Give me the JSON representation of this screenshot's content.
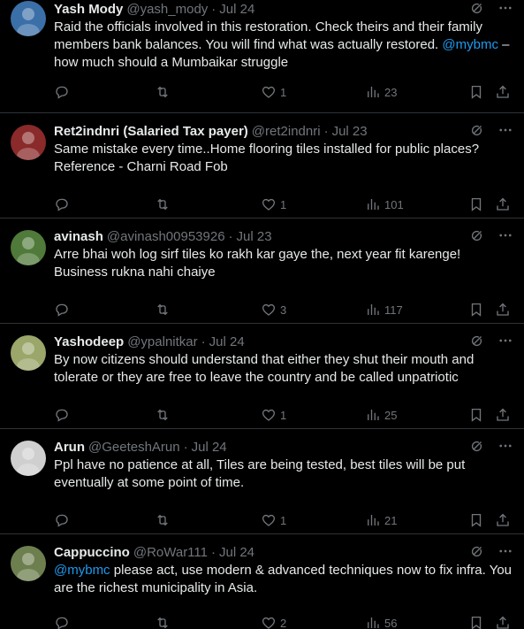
{
  "tweets": [
    {
      "name": "Yash Mody",
      "handle": "@yash_mody",
      "date": "Jul 24",
      "text_before": "Raid the officials involved in this restoration. Check theirs and their family members bank balances. You will find what was actually restored. ",
      "mention": "@mybmc",
      "text_after": " – how much should a Mumbaikar struggle",
      "likes": "1",
      "views": "23",
      "avatar_color": "#3b6fa8"
    },
    {
      "name": "Ret2indnri (Salaried Tax payer)",
      "handle": "@ret2indnri",
      "date": "Jul 23",
      "text_before": "Same mistake every time..Home flooring tiles installed for public places? Reference - Charni Road Fob",
      "mention": "",
      "text_after": "",
      "likes": "1",
      "views": "101",
      "avatar_color": "#8a2a2a"
    },
    {
      "name": "avinash",
      "handle": "@avinash00953926",
      "date": "Jul 23",
      "text_before": "Arre bhai woh log sirf tiles ko rakh kar gaye the, next year fit karenge! Business rukna nahi chaiye",
      "mention": "",
      "text_after": "",
      "likes": "3",
      "views": "117",
      "avatar_color": "#4f7a3a"
    },
    {
      "name": "Yashodeep",
      "handle": "@ypalnitkar",
      "date": "Jul 24",
      "text_before": "By now citizens should understand that either they shut their mouth and tolerate or they are free to leave the country and be called unpatriotic",
      "mention": "",
      "text_after": "",
      "likes": "1",
      "views": "25",
      "avatar_color": "#9aa66a"
    },
    {
      "name": "Arun",
      "handle": "@GeeteshArun",
      "date": "Jul 24",
      "text_before": "Ppl have no patience at all, Tiles are being tested, best tiles will be put eventually at some point of time.",
      "mention": "",
      "text_after": "",
      "likes": "1",
      "views": "21",
      "avatar_color": "#cfcfcf"
    },
    {
      "name": "Cappuccino",
      "handle": "@RoWar111",
      "date": "Jul 24",
      "text_before": "",
      "mention": "@mybmc",
      "text_after": " please act, use modern & advanced techniques now to fix infra. You are the richest municipality in Asia.",
      "likes": "2",
      "views": "56",
      "avatar_color": "#6d7f4e"
    }
  ],
  "colors": {
    "background": "#000000",
    "text": "#e7e9ea",
    "muted": "#71767b",
    "link": "#1d9bf0",
    "divider": "#2f3336"
  },
  "icons": {
    "reply": "reply-icon",
    "retweet": "retweet-icon",
    "like": "heart-icon",
    "views": "views-icon",
    "bookmark": "bookmark-icon",
    "share": "share-icon",
    "grok": "grok-icon",
    "more": "more-icon"
  }
}
